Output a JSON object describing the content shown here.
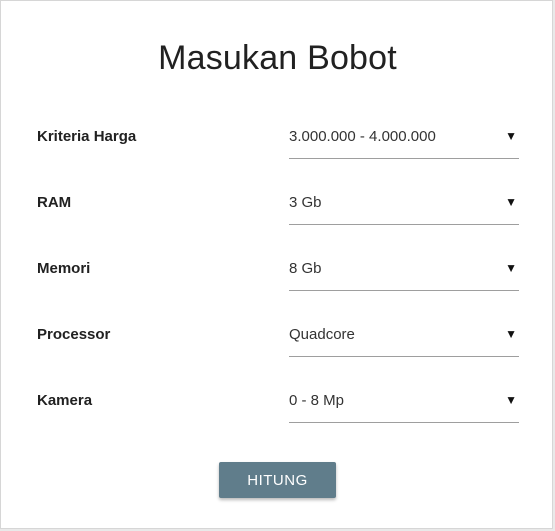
{
  "form": {
    "title": "Masukan Bobot",
    "fields": [
      {
        "label": "Kriteria Harga",
        "value": "3.000.000 - 4.000.000"
      },
      {
        "label": "RAM",
        "value": "3 Gb"
      },
      {
        "label": "Memori",
        "value": "8 Gb"
      },
      {
        "label": "Processor",
        "value": "Quadcore"
      },
      {
        "label": "Kamera",
        "value": "0 - 8 Mp"
      }
    ],
    "dropdown_icon": "triangle-down-icon",
    "submit_label": "HITUNG"
  },
  "colors": {
    "button": "#607d8b",
    "underline": "#9e9e9e",
    "text": "#212121"
  }
}
